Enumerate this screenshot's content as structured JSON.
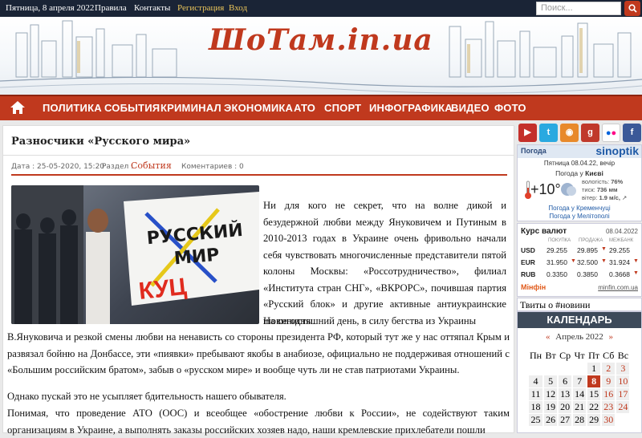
{
  "topbar": {
    "date": "Пятница, 8 апреля 2022",
    "links": [
      "Правила",
      "Контакты"
    ],
    "register": "Регистрация",
    "login": "Вход",
    "search_placeholder": "Поиск..."
  },
  "header": {
    "logo": "ШоТам.in.ua"
  },
  "nav": {
    "items": [
      "ПОЛИТИКА",
      "СОБЫТИЯ",
      "КРИМИНАЛ",
      "ЭКОНОМИКА",
      "АТО",
      "СПОРТ",
      "ИНФОГРАФИКА",
      "ВИДЕО",
      "ФОТО"
    ]
  },
  "article": {
    "title": "Разносчики «Русского мира»",
    "date": "Дата : 25-05-2020, 15:20",
    "section_label": "Раздел :",
    "section": "События",
    "comments": "Коментариев : 0",
    "photo_text": "РУССКИЙ МИР",
    "p1": "Ни для кого не секрет, что на волне дикой и безудержной любви между Януковичем и Путиным в 2010-2013 годах в Украине очень фривольно начали себя чувствовать многочисленные представители пятой колоны Москвы: «Россотрудничество», филиал «Института стран СНГ», «ВКРОРС», почившая партия «Русский блок» и другие активные антиукраинские шовинисты.",
    "p2a": "На сегодняшний день, в силу бегства из Украины",
    "p2b": "В.Януковича и резкой смены любви на ненависть со стороны президента РФ, который тут же у нас оттяпал Крым и развязал бойню на Донбассе, эти «пиявки» пребывают якобы в анабиозе, официально не поддерживая отношений с «Большим российским братом», забыв о «русском мире» и вообще чуть ли не став патриотами Украины.",
    "p3": "Однако пускай это не усыпляет бдительность нашего обывателя.",
    "p4": "Понимая, что проведение АТО (ООС) и всеобщее «обострение любви к России», не содействуют таким организациям в Украине, а выполнять заказы российских хозяев надо, наши кремлевские прихлебатели пошли"
  },
  "weather": {
    "label": "Погода",
    "brand": "sinoptik",
    "date": "Пятница 08.04.22, вечір",
    "city_label": "Погода у",
    "city": "Києві",
    "temp": "+10°",
    "humidity_label": "вологість:",
    "humidity": "76%",
    "pressure_label": "тиск:",
    "pressure": "736 мм",
    "wind_label": "вітер:",
    "wind": "1.9 м/с,",
    "link1": "Погода у Кременчуці",
    "link2": "Погода у Мелітополі"
  },
  "currency": {
    "title": "Курс валют",
    "date": "08.04.2022",
    "cols": [
      "ПОКУПКА",
      "ПРОДАЖА",
      "МЕЖБАНК"
    ],
    "rows": [
      {
        "code": "USD",
        "buy": "29.255",
        "sell": "29.895",
        "inter": "29.255"
      },
      {
        "code": "EUR",
        "buy": "31.950",
        "sell": "32.500",
        "inter": "31.924"
      },
      {
        "code": "RUB",
        "buy": "0.3350",
        "sell": "0.3850",
        "inter": "0.3668"
      }
    ],
    "source": "Мінфін",
    "source_url": "minfin.com.ua"
  },
  "tweets": {
    "title": "Твиты о #новини"
  },
  "calendar": {
    "title": "КАЛЕНДАРЬ",
    "prev": "«",
    "month": "Апрель 2022",
    "next": "»",
    "weekdays": [
      "Пн",
      "Вт",
      "Ср",
      "Чт",
      "Пт",
      "Сб",
      "Вс"
    ],
    "weeks": [
      [
        "",
        "",
        "",
        "",
        "1",
        "2",
        "3"
      ],
      [
        "4",
        "5",
        "6",
        "7",
        "8",
        "9",
        "10"
      ],
      [
        "11",
        "12",
        "13",
        "14",
        "15",
        "16",
        "17"
      ],
      [
        "18",
        "19",
        "20",
        "21",
        "22",
        "23",
        "24"
      ],
      [
        "25",
        "26",
        "27",
        "28",
        "29",
        "30",
        ""
      ]
    ],
    "today": "8"
  }
}
